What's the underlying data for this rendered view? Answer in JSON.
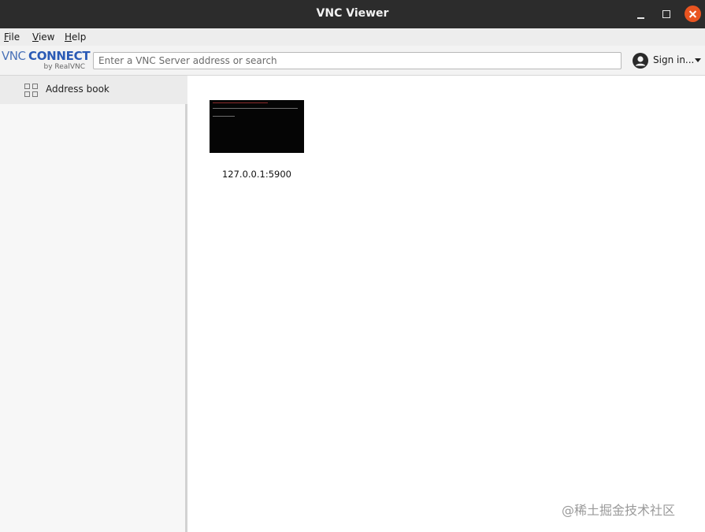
{
  "window": {
    "title": "VNC Viewer"
  },
  "menu": {
    "file_accel": "F",
    "file_rest": "ile",
    "view_accel": "V",
    "view_rest": "iew",
    "help_accel": "H",
    "help_rest": "elp"
  },
  "logo": {
    "vnc": "VNC",
    "connect": "CONNECT",
    "by": "by RealVNC"
  },
  "search": {
    "placeholder": "Enter a VNC Server address or search",
    "value": ""
  },
  "account": {
    "signin_label": "Sign in..."
  },
  "sidebar": {
    "items": [
      {
        "label": "Address book",
        "icon": "grid-icon"
      }
    ]
  },
  "connections": [
    {
      "label": "127.0.0.1:5900"
    }
  ],
  "watermark": "@稀土掘金技术社区",
  "colors": {
    "titlebar": "#2c2c2c",
    "close_button": "#e95420",
    "brand": "#2a5ab5"
  }
}
